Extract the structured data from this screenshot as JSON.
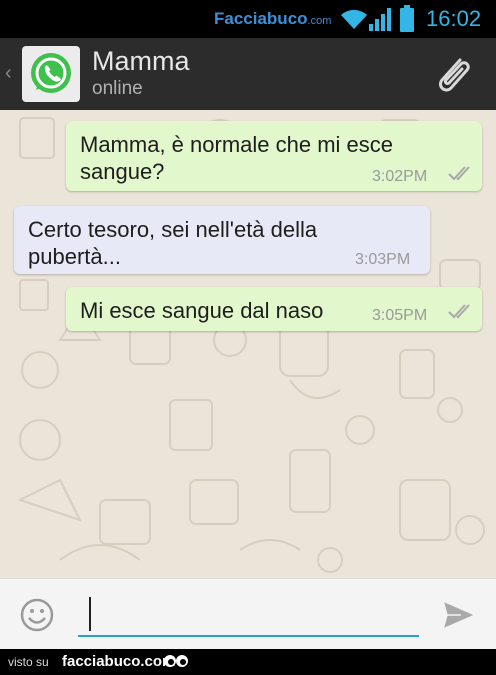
{
  "status_bar": {
    "watermark": "Facciabuco",
    "watermark_domain": ".com",
    "time": "16:02",
    "icons": [
      "wifi-icon",
      "signal-icon",
      "battery-icon"
    ]
  },
  "header": {
    "contact_name": "Mamma",
    "status": "online",
    "icons": [
      "back-chevron-icon",
      "whatsapp-logo-icon",
      "paperclip-icon"
    ]
  },
  "messages": [
    {
      "direction": "outgoing",
      "lines": [
        "Mamma, è normale che mi esce",
        "sangue?"
      ],
      "time": "3:02PM",
      "status": "read"
    },
    {
      "direction": "incoming",
      "lines": [
        "Certo tesoro, sei nell'età della",
        "pubertà..."
      ],
      "time": "3:03PM"
    },
    {
      "direction": "outgoing",
      "lines": [
        "Mi esce sangue dal naso"
      ],
      "time": "3:05PM",
      "status": "read"
    }
  ],
  "composer": {
    "value": "",
    "icons": [
      "emoji-icon",
      "send-icon"
    ]
  },
  "footer": {
    "prefix": "visto su",
    "site": "facciabuco.com",
    "icon": "eyes-icon"
  },
  "colors": {
    "status_accent": "#33b5e5",
    "action_bar": "#2c2c2c",
    "chat_background": "#ebe5d9",
    "outgoing_bubble": "#e2f7cb",
    "incoming_bubble": "#e7e9f6",
    "input_underline": "#2c9fc8"
  }
}
